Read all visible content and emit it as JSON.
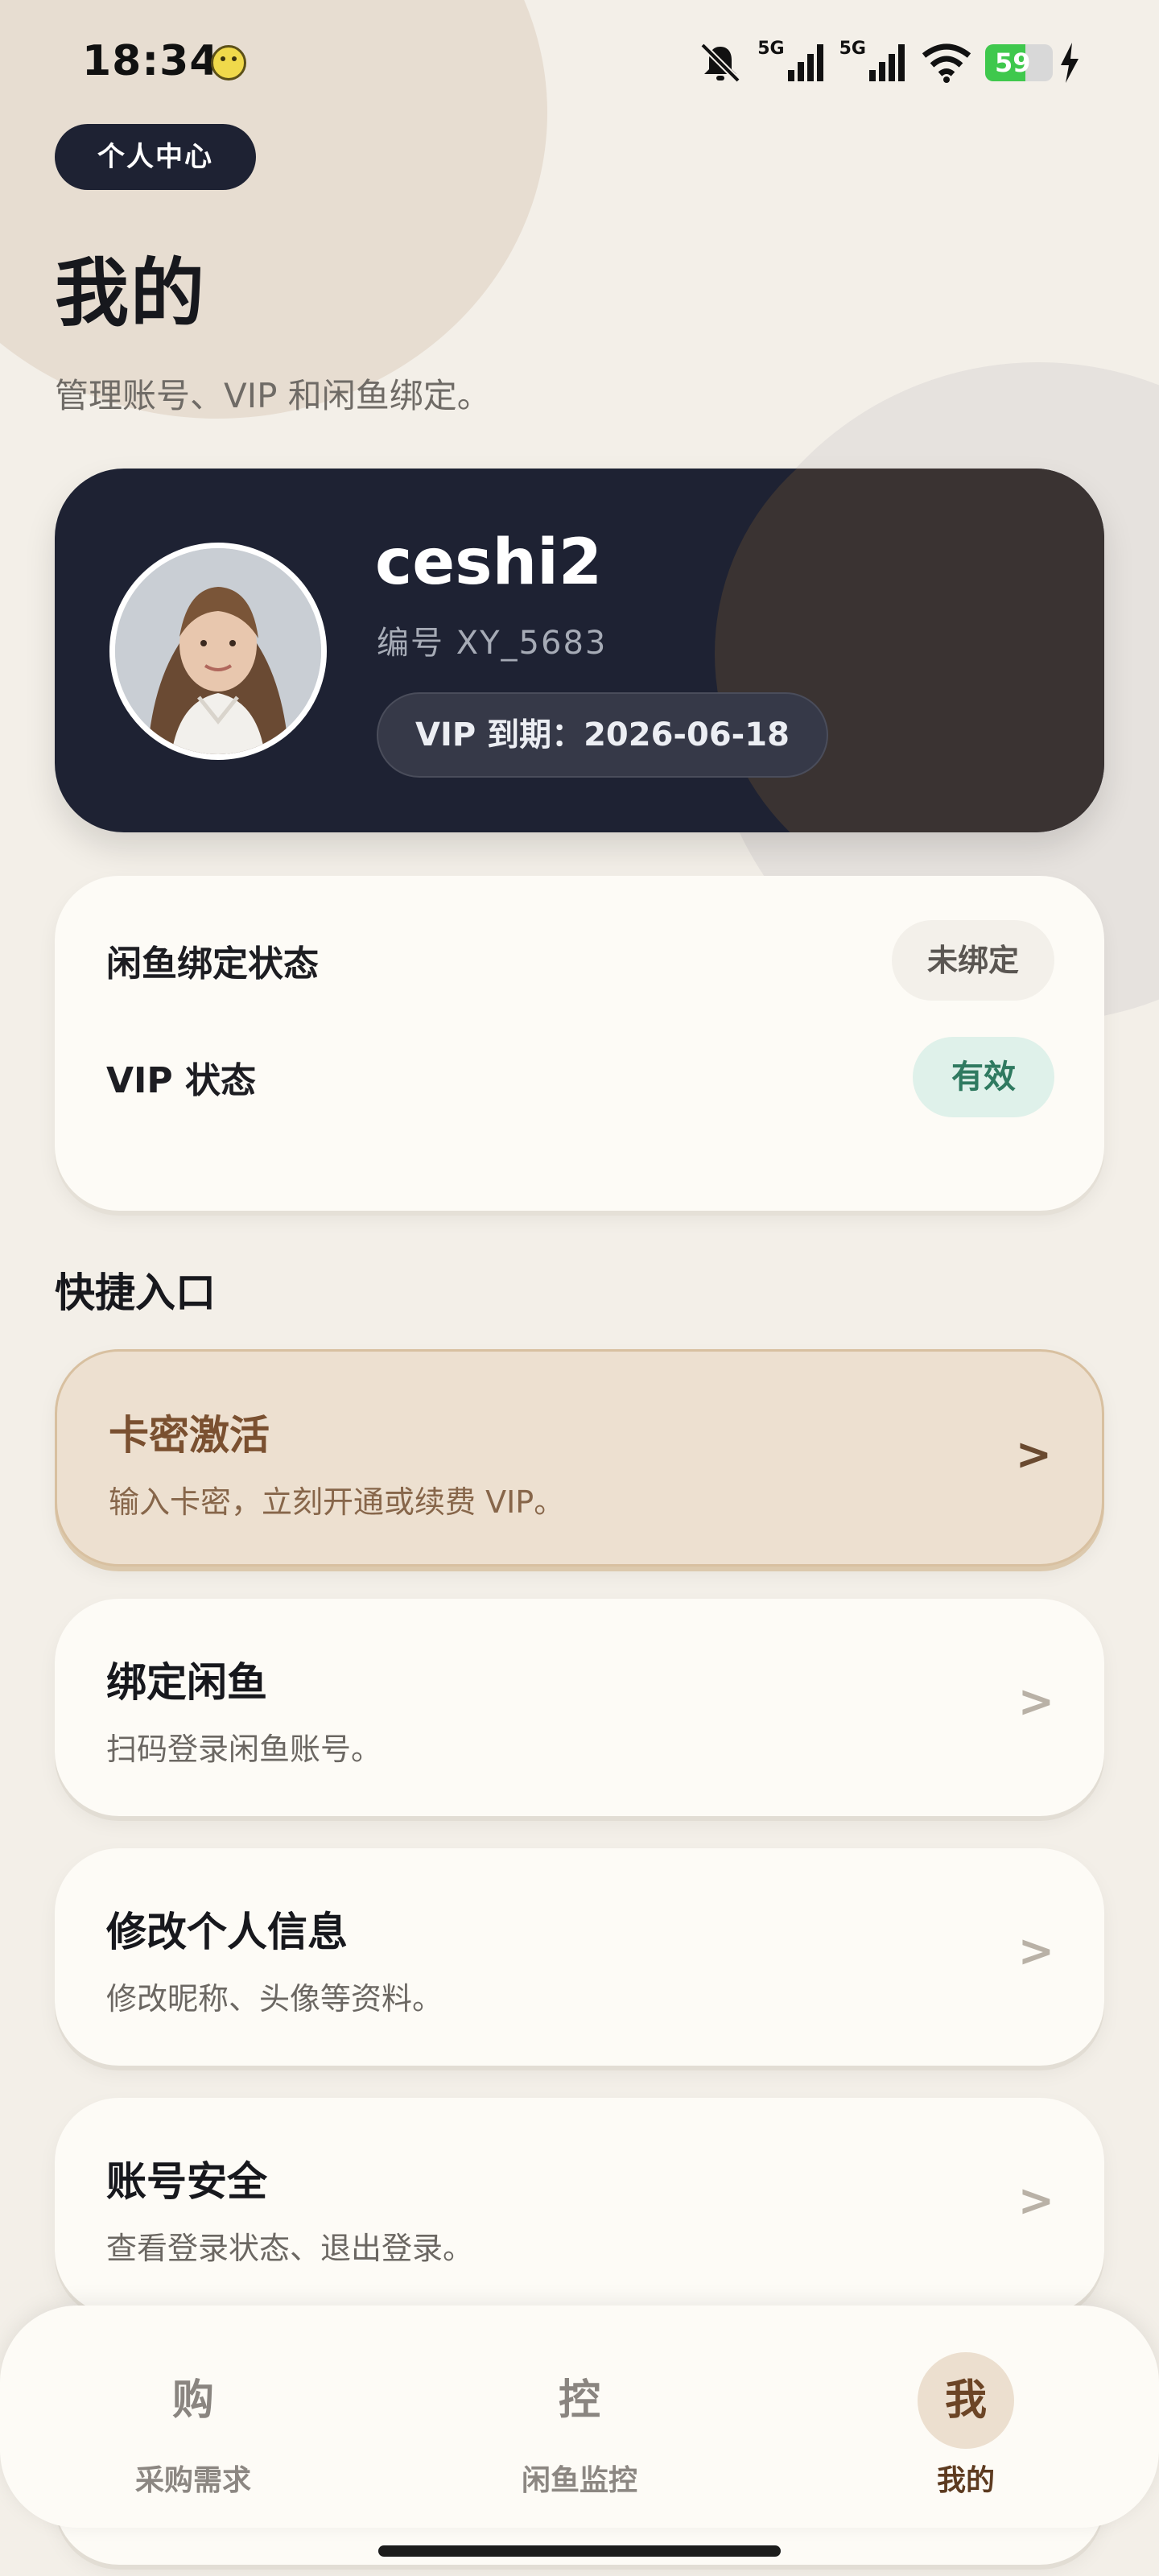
{
  "status_bar": {
    "time": "18:34",
    "battery": "59",
    "network_1": "5G",
    "network_2": "5G"
  },
  "header": {
    "badge": "个人中心",
    "title": "我的",
    "subtitle": "管理账号、VIP 和闲鱼绑定。"
  },
  "profile": {
    "name": "ceshi2",
    "id": "编号 XY_5683",
    "vip_expiry": "VIP 到期：2026-06-18"
  },
  "status_card": {
    "bind_label": "闲鱼绑定状态",
    "bind_value": "未绑定",
    "vip_label": "VIP 状态",
    "vip_value": "有效"
  },
  "quick": {
    "title": "快捷入口",
    "items": [
      {
        "title": "卡密激活",
        "desc": "输入卡密，立刻开通或续费 VIP。",
        "arrow": ">"
      },
      {
        "title": "绑定闲鱼",
        "desc": "扫码登录闲鱼账号。",
        "arrow": ">"
      },
      {
        "title": "修改个人信息",
        "desc": "修改昵称、头像等资料。",
        "arrow": ">"
      },
      {
        "title": "账号安全",
        "desc": "查看登录状态、退出登录。",
        "arrow": ">"
      }
    ]
  },
  "nav": {
    "items": [
      {
        "glyph": "购",
        "label": "采购需求"
      },
      {
        "glyph": "控",
        "label": "闲鱼监控"
      },
      {
        "glyph": "我",
        "label": "我的"
      }
    ]
  },
  "colors": {
    "background": "#f3efe8",
    "dark_card": "#1e2233",
    "accent_brown": "#7a5030",
    "valid_green": "#2f7a60"
  }
}
